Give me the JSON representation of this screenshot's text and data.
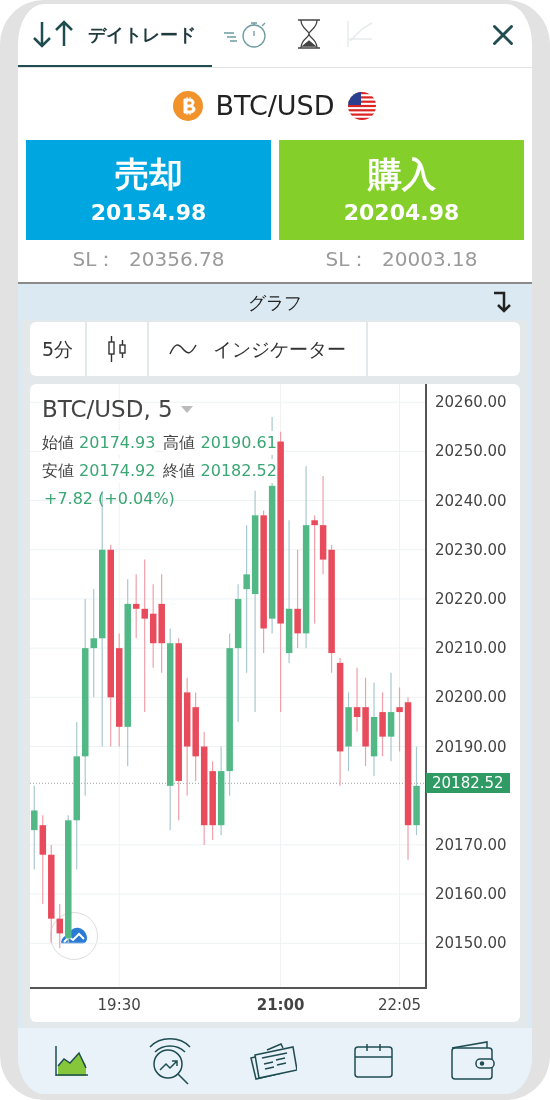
{
  "tabs": [
    {
      "kind": "arrows",
      "label": "デイトレード",
      "selected": true,
      "disabled": false
    },
    {
      "kind": "stopwatch",
      "selected": false,
      "disabled": false
    },
    {
      "kind": "hourglass",
      "selected": false,
      "disabled": false
    },
    {
      "kind": "chart",
      "selected": false,
      "disabled": true
    }
  ],
  "instrument": {
    "name": "BTC/USD"
  },
  "trade_buttons": [
    {
      "kind": "sell",
      "label": "売却",
      "price": "20154.98",
      "sl_label": "SL：",
      "sl_value": "20356.78"
    },
    {
      "kind": "buy",
      "label": "購入",
      "price": "20204.98",
      "sl_label": "SL：",
      "sl_value": "20003.18"
    }
  ],
  "section": {
    "title": "グラフ"
  },
  "toolbar": {
    "interval": "5分",
    "indicators": "インジケーター"
  },
  "chart": {
    "symbol": "BTC/USD, 5",
    "ohlc": [
      {
        "label": "始値",
        "value": "20174.93"
      },
      {
        "label": "高値",
        "value": "20190.61"
      },
      {
        "label": "安値",
        "value": "20174.92"
      },
      {
        "label": "終値",
        "value": "20182.52"
      }
    ],
    "change": "+7.82 (+0.04%)",
    "last_price": "20182.52",
    "chart_data": {
      "type": "candlestick",
      "categories": [
        null,
        null,
        null,
        null,
        null,
        null,
        null,
        null,
        null,
        null,
        "19:30",
        null,
        null,
        null,
        null,
        null,
        null,
        null,
        null,
        null,
        null,
        null,
        null,
        null,
        null,
        null,
        null,
        null,
        null,
        "21:00",
        null,
        null,
        null,
        null,
        null,
        null,
        null,
        null,
        null,
        null,
        null,
        null,
        null,
        "22:05",
        null,
        null
      ],
      "ohlc": [
        [
          20173,
          20182,
          20165,
          20177
        ],
        [
          20174,
          20176,
          20158,
          20168
        ],
        [
          20168,
          20170,
          20150,
          20155
        ],
        [
          20155,
          20158,
          20149,
          20152
        ],
        [
          20151,
          20176,
          20150,
          20175
        ],
        [
          20175,
          20195,
          20165,
          20188
        ],
        [
          20188,
          20220,
          20180,
          20210
        ],
        [
          20210,
          20222,
          20200,
          20212
        ],
        [
          20212,
          20242,
          20190,
          20230
        ],
        [
          20230,
          20231,
          20190,
          20200
        ],
        [
          20210,
          20213,
          20190,
          20194
        ],
        [
          20194,
          20224,
          20186,
          20219
        ],
        [
          20219,
          20225,
          20212,
          20218
        ],
        [
          20218,
          20228,
          20197,
          20216
        ],
        [
          20217,
          20223,
          20206,
          20211
        ],
        [
          20219,
          20225,
          20205,
          20211
        ],
        [
          20182,
          20214,
          20173,
          20211
        ],
        [
          20211,
          20212,
          20175,
          20183
        ],
        [
          20201,
          20204,
          20180,
          20190
        ],
        [
          20198,
          20201,
          20183,
          20188
        ],
        [
          20190,
          20193,
          20170,
          20174
        ],
        [
          20185,
          20187,
          20171,
          20174
        ],
        [
          20174,
          20190,
          20172,
          20185
        ],
        [
          20185,
          20213,
          20180,
          20210
        ],
        [
          20210,
          20223,
          20195,
          20220
        ],
        [
          20222,
          20235,
          20205,
          20225
        ],
        [
          20221,
          20242,
          20197,
          20237
        ],
        [
          20237,
          20238,
          20209,
          20214
        ],
        [
          20216,
          20257,
          20213,
          20243
        ],
        [
          20252,
          20254,
          20197,
          20215
        ],
        [
          20209,
          20236,
          20207,
          20218
        ],
        [
          20218,
          20230,
          20210,
          20213
        ],
        [
          20213,
          20247,
          20210,
          20235
        ],
        [
          20236,
          20237,
          20215,
          20235
        ],
        [
          20235,
          20245,
          20225,
          20228
        ],
        [
          20230,
          20231,
          20205,
          20209
        ],
        [
          20207,
          20208,
          20182,
          20189
        ],
        [
          20190,
          20201,
          20185,
          20198
        ],
        [
          20198,
          20206,
          20193,
          20196
        ],
        [
          20198,
          20204,
          20186,
          20190
        ],
        [
          20188,
          20203,
          20184,
          20196
        ],
        [
          20197,
          20201,
          20188,
          20192
        ],
        [
          20192,
          20205,
          20187,
          20197
        ],
        [
          20198,
          20202,
          20189,
          20197
        ],
        [
          20199,
          20200,
          20167,
          20174
        ],
        [
          20174,
          20190,
          20172,
          20182
        ]
      ],
      "ylim": [
        20140.7,
        20263.7
      ],
      "grid": true,
      "ref_lines": [
        {
          "axis": "y",
          "value": 20182.52
        }
      ],
      "yticks": [
        {
          "value": 20260,
          "label": "20260.00"
        },
        {
          "value": 20250,
          "label": "20250.00"
        },
        {
          "value": 20240,
          "label": "20240.00"
        },
        {
          "value": 20230,
          "label": "20230.00"
        },
        {
          "value": 20220,
          "label": "20220.00"
        },
        {
          "value": 20210,
          "label": "20210.00"
        },
        {
          "value": 20200,
          "label": "20200.00"
        },
        {
          "value": 20190,
          "label": "20190.00"
        },
        {
          "value": 20170,
          "label": "20170.00"
        },
        {
          "value": 20160,
          "label": "20160.00"
        },
        {
          "value": 20150,
          "label": "20150.00"
        }
      ]
    },
    "x_label_styles": [
      {
        "bold": false
      },
      {
        "bold": true
      },
      {
        "bold": false
      }
    ]
  },
  "bottom_nav": [
    {
      "kind": "chart",
      "selected": true
    },
    {
      "kind": "analysis",
      "selected": false
    },
    {
      "kind": "news",
      "selected": false
    },
    {
      "kind": "calendar",
      "selected": false
    },
    {
      "kind": "wallet",
      "selected": false
    }
  ]
}
